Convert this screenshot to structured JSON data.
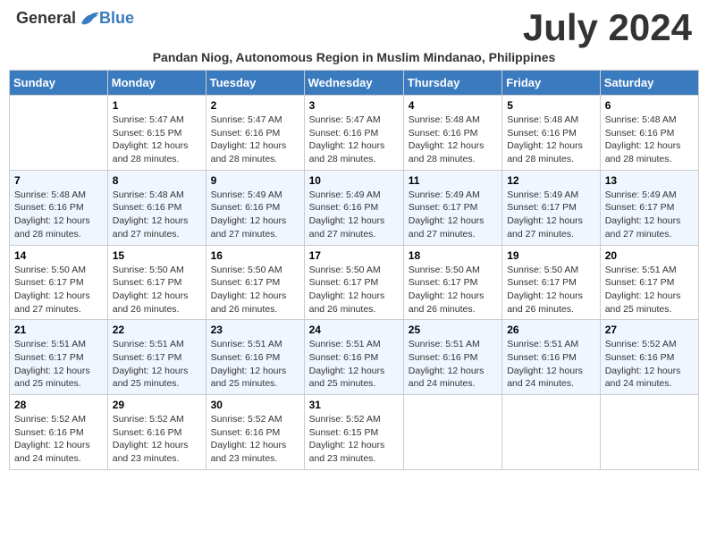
{
  "logo": {
    "general": "General",
    "blue": "Blue"
  },
  "title": "July 2024",
  "subtitle": "Pandan Niog, Autonomous Region in Muslim Mindanao, Philippines",
  "days_of_week": [
    "Sunday",
    "Monday",
    "Tuesday",
    "Wednesday",
    "Thursday",
    "Friday",
    "Saturday"
  ],
  "weeks": [
    [
      {
        "day": "",
        "info": ""
      },
      {
        "day": "1",
        "info": "Sunrise: 5:47 AM\nSunset: 6:15 PM\nDaylight: 12 hours\nand 28 minutes."
      },
      {
        "day": "2",
        "info": "Sunrise: 5:47 AM\nSunset: 6:16 PM\nDaylight: 12 hours\nand 28 minutes."
      },
      {
        "day": "3",
        "info": "Sunrise: 5:47 AM\nSunset: 6:16 PM\nDaylight: 12 hours\nand 28 minutes."
      },
      {
        "day": "4",
        "info": "Sunrise: 5:48 AM\nSunset: 6:16 PM\nDaylight: 12 hours\nand 28 minutes."
      },
      {
        "day": "5",
        "info": "Sunrise: 5:48 AM\nSunset: 6:16 PM\nDaylight: 12 hours\nand 28 minutes."
      },
      {
        "day": "6",
        "info": "Sunrise: 5:48 AM\nSunset: 6:16 PM\nDaylight: 12 hours\nand 28 minutes."
      }
    ],
    [
      {
        "day": "7",
        "info": "Sunrise: 5:48 AM\nSunset: 6:16 PM\nDaylight: 12 hours\nand 28 minutes."
      },
      {
        "day": "8",
        "info": "Sunrise: 5:48 AM\nSunset: 6:16 PM\nDaylight: 12 hours\nand 27 minutes."
      },
      {
        "day": "9",
        "info": "Sunrise: 5:49 AM\nSunset: 6:16 PM\nDaylight: 12 hours\nand 27 minutes."
      },
      {
        "day": "10",
        "info": "Sunrise: 5:49 AM\nSunset: 6:16 PM\nDaylight: 12 hours\nand 27 minutes."
      },
      {
        "day": "11",
        "info": "Sunrise: 5:49 AM\nSunset: 6:17 PM\nDaylight: 12 hours\nand 27 minutes."
      },
      {
        "day": "12",
        "info": "Sunrise: 5:49 AM\nSunset: 6:17 PM\nDaylight: 12 hours\nand 27 minutes."
      },
      {
        "day": "13",
        "info": "Sunrise: 5:49 AM\nSunset: 6:17 PM\nDaylight: 12 hours\nand 27 minutes."
      }
    ],
    [
      {
        "day": "14",
        "info": "Sunrise: 5:50 AM\nSunset: 6:17 PM\nDaylight: 12 hours\nand 27 minutes."
      },
      {
        "day": "15",
        "info": "Sunrise: 5:50 AM\nSunset: 6:17 PM\nDaylight: 12 hours\nand 26 minutes."
      },
      {
        "day": "16",
        "info": "Sunrise: 5:50 AM\nSunset: 6:17 PM\nDaylight: 12 hours\nand 26 minutes."
      },
      {
        "day": "17",
        "info": "Sunrise: 5:50 AM\nSunset: 6:17 PM\nDaylight: 12 hours\nand 26 minutes."
      },
      {
        "day": "18",
        "info": "Sunrise: 5:50 AM\nSunset: 6:17 PM\nDaylight: 12 hours\nand 26 minutes."
      },
      {
        "day": "19",
        "info": "Sunrise: 5:50 AM\nSunset: 6:17 PM\nDaylight: 12 hours\nand 26 minutes."
      },
      {
        "day": "20",
        "info": "Sunrise: 5:51 AM\nSunset: 6:17 PM\nDaylight: 12 hours\nand 25 minutes."
      }
    ],
    [
      {
        "day": "21",
        "info": "Sunrise: 5:51 AM\nSunset: 6:17 PM\nDaylight: 12 hours\nand 25 minutes."
      },
      {
        "day": "22",
        "info": "Sunrise: 5:51 AM\nSunset: 6:17 PM\nDaylight: 12 hours\nand 25 minutes."
      },
      {
        "day": "23",
        "info": "Sunrise: 5:51 AM\nSunset: 6:16 PM\nDaylight: 12 hours\nand 25 minutes."
      },
      {
        "day": "24",
        "info": "Sunrise: 5:51 AM\nSunset: 6:16 PM\nDaylight: 12 hours\nand 25 minutes."
      },
      {
        "day": "25",
        "info": "Sunrise: 5:51 AM\nSunset: 6:16 PM\nDaylight: 12 hours\nand 24 minutes."
      },
      {
        "day": "26",
        "info": "Sunrise: 5:51 AM\nSunset: 6:16 PM\nDaylight: 12 hours\nand 24 minutes."
      },
      {
        "day": "27",
        "info": "Sunrise: 5:52 AM\nSunset: 6:16 PM\nDaylight: 12 hours\nand 24 minutes."
      }
    ],
    [
      {
        "day": "28",
        "info": "Sunrise: 5:52 AM\nSunset: 6:16 PM\nDaylight: 12 hours\nand 24 minutes."
      },
      {
        "day": "29",
        "info": "Sunrise: 5:52 AM\nSunset: 6:16 PM\nDaylight: 12 hours\nand 23 minutes."
      },
      {
        "day": "30",
        "info": "Sunrise: 5:52 AM\nSunset: 6:16 PM\nDaylight: 12 hours\nand 23 minutes."
      },
      {
        "day": "31",
        "info": "Sunrise: 5:52 AM\nSunset: 6:15 PM\nDaylight: 12 hours\nand 23 minutes."
      },
      {
        "day": "",
        "info": ""
      },
      {
        "day": "",
        "info": ""
      },
      {
        "day": "",
        "info": ""
      }
    ]
  ]
}
